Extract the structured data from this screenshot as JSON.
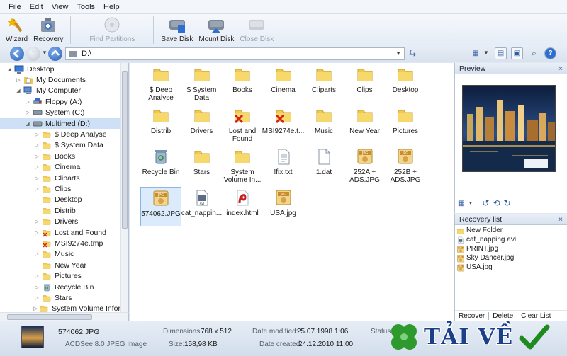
{
  "menu": [
    "File",
    "Edit",
    "View",
    "Tools",
    "Help"
  ],
  "toolbar": {
    "wizard": "Wizard",
    "recovery": "Recovery",
    "find_partitions": "Find Partitions",
    "save_disk": "Save Disk",
    "mount_disk": "Mount Disk",
    "close_disk": "Close Disk"
  },
  "address": {
    "path": "D:\\"
  },
  "tree": [
    {
      "label": "Desktop",
      "icon": "desktop-icon"
    },
    {
      "label": "My Documents",
      "icon": "documents-icon"
    },
    {
      "label": "My Computer",
      "icon": "computer-icon"
    },
    {
      "label": "Floppy (A:)",
      "icon": "floppy-icon"
    },
    {
      "label": "System (C:)",
      "icon": "drive-icon"
    },
    {
      "label": "Multimed (D:)",
      "icon": "drive-icon"
    },
    {
      "label": "$ Deep Analyse",
      "icon": "folder-icon"
    },
    {
      "label": "$ System Data",
      "icon": "folder-icon"
    },
    {
      "label": "Books",
      "icon": "folder-icon"
    },
    {
      "label": "Cinema",
      "icon": "folder-icon"
    },
    {
      "label": "Cliparts",
      "icon": "folder-icon"
    },
    {
      "label": "Clips",
      "icon": "folder-icon"
    },
    {
      "label": "Desktop",
      "icon": "folder-icon"
    },
    {
      "label": "Distrib",
      "icon": "folder-icon"
    },
    {
      "label": "Drivers",
      "icon": "folder-icon"
    },
    {
      "label": "Lost and Found",
      "icon": "deleted-folder-icon"
    },
    {
      "label": "MSI9274e.tmp",
      "icon": "deleted-folder-icon"
    },
    {
      "label": "Music",
      "icon": "folder-icon"
    },
    {
      "label": "New Year",
      "icon": "folder-icon"
    },
    {
      "label": "Pictures",
      "icon": "folder-icon"
    },
    {
      "label": "Recycle Bin",
      "icon": "recycle-bin-icon"
    },
    {
      "label": "Stars",
      "icon": "folder-icon"
    },
    {
      "label": "System Volume Infor",
      "icon": "folder-icon"
    }
  ],
  "files": [
    {
      "label": "$ Deep Analyse",
      "icon": "folder-icon"
    },
    {
      "label": "$ System Data",
      "icon": "folder-icon"
    },
    {
      "label": "Books",
      "icon": "folder-icon"
    },
    {
      "label": "Cinema",
      "icon": "folder-icon"
    },
    {
      "label": "Cliparts",
      "icon": "folder-icon"
    },
    {
      "label": "Clips",
      "icon": "folder-icon"
    },
    {
      "label": "Desktop",
      "icon": "folder-icon"
    },
    {
      "label": "Distrib",
      "icon": "folder-icon"
    },
    {
      "label": "Drivers",
      "icon": "folder-icon"
    },
    {
      "label": "Lost and Found",
      "icon": "deleted-folder-icon"
    },
    {
      "label": "MSI9274e.t...",
      "icon": "deleted-folder-icon"
    },
    {
      "label": "Music",
      "icon": "folder-icon"
    },
    {
      "label": "New Year",
      "icon": "folder-icon"
    },
    {
      "label": "Pictures",
      "icon": "folder-icon"
    },
    {
      "label": "Recycle Bin",
      "icon": "recycle-bin-icon"
    },
    {
      "label": "Stars",
      "icon": "folder-icon"
    },
    {
      "label": "System Volume In...",
      "icon": "folder-icon"
    },
    {
      "label": "!fix.txt",
      "icon": "text-file-icon"
    },
    {
      "label": "1.dat",
      "icon": "file-icon"
    },
    {
      "label": "252A + ADS.JPG",
      "icon": "jpg-icon"
    },
    {
      "label": "252B + ADS.JPG",
      "icon": "jpg-icon"
    },
    {
      "label": "574062.JPG",
      "icon": "jpg-icon"
    },
    {
      "label": "cat_nappin...",
      "icon": "avi-icon"
    },
    {
      "label": "index.html",
      "icon": "html-icon"
    },
    {
      "label": "USA.jpg",
      "icon": "jpg-icon"
    }
  ],
  "preview": {
    "title": "Preview"
  },
  "recovery_list": {
    "title": "Recovery list",
    "items": [
      {
        "label": "New Folder",
        "icon": "folder-icon"
      },
      {
        "label": "cat_napping.avi",
        "icon": "avi-icon"
      },
      {
        "label": "PRINT.jpg",
        "icon": "jpg-icon"
      },
      {
        "label": "Sky Dancer.jpg",
        "icon": "jpg-icon"
      },
      {
        "label": "USA.jpg",
        "icon": "jpg-icon"
      }
    ],
    "actions": [
      "Recover",
      "Delete",
      "Clear List"
    ]
  },
  "status": {
    "filename": "574062.JPG",
    "filetype": "ACDSee 8.0 JPEG Image",
    "dimensions_label": "Dimensions:",
    "dimensions": "768 x 512",
    "size_label": "Size:",
    "size": "158,98 KB",
    "modified_label": "Date modified:",
    "modified": "25.07.1998 1:06",
    "created_label": "Date created:",
    "created": "24.12.2010 11:00",
    "status_label": "Status:"
  },
  "watermark": {
    "text": "TẢI VỀ"
  },
  "colors": {
    "folder": "#f2c94c",
    "accent": "#2c5aa0",
    "selection": "#cde0f5"
  }
}
